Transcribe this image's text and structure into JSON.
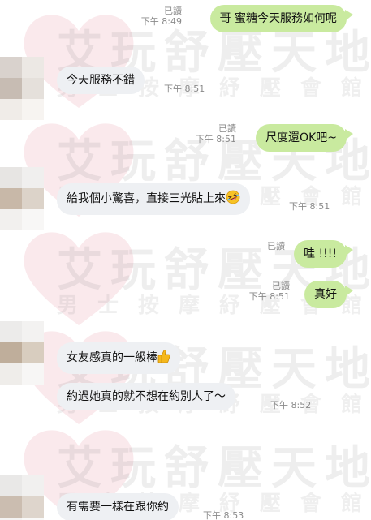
{
  "watermark": {
    "brand": "艾玩舒壓天地",
    "tagline": "男士按摩紓壓會館"
  },
  "colors": {
    "outgoing_bubble": "#c9ea9f",
    "incoming_bubble": "#eef0f3",
    "meta_text": "#8a8a8a"
  },
  "messages": [
    {
      "direction": "out",
      "text": "哥  蜜糖今天服務如何呢",
      "read": "已讀",
      "time": "下午 8:49"
    },
    {
      "direction": "in",
      "text": "今天服務不錯",
      "time": "下午 8:51"
    },
    {
      "direction": "out",
      "text": "尺度還OK吧~",
      "read": "已讀",
      "time": "下午 8:51"
    },
    {
      "direction": "in",
      "text": "給我個小驚喜，直接三光貼上來",
      "emoji": "rolling-laughing-emoji",
      "time": "下午 8:51"
    },
    {
      "direction": "out",
      "text": "哇 !!!!",
      "read": "已讀",
      "time": ""
    },
    {
      "direction": "out",
      "text": "真好",
      "read": "已讀",
      "time": "下午 8:51"
    },
    {
      "direction": "in",
      "text": "女友感真的一級棒",
      "emoji": "thumbs-up-emoji",
      "time": ""
    },
    {
      "direction": "in",
      "text": "約過她真的就不想在約別人了～",
      "time": "下午 8:52"
    },
    {
      "direction": "in",
      "text": "有需要一樣在跟你約",
      "time": "下午 8:53"
    }
  ]
}
